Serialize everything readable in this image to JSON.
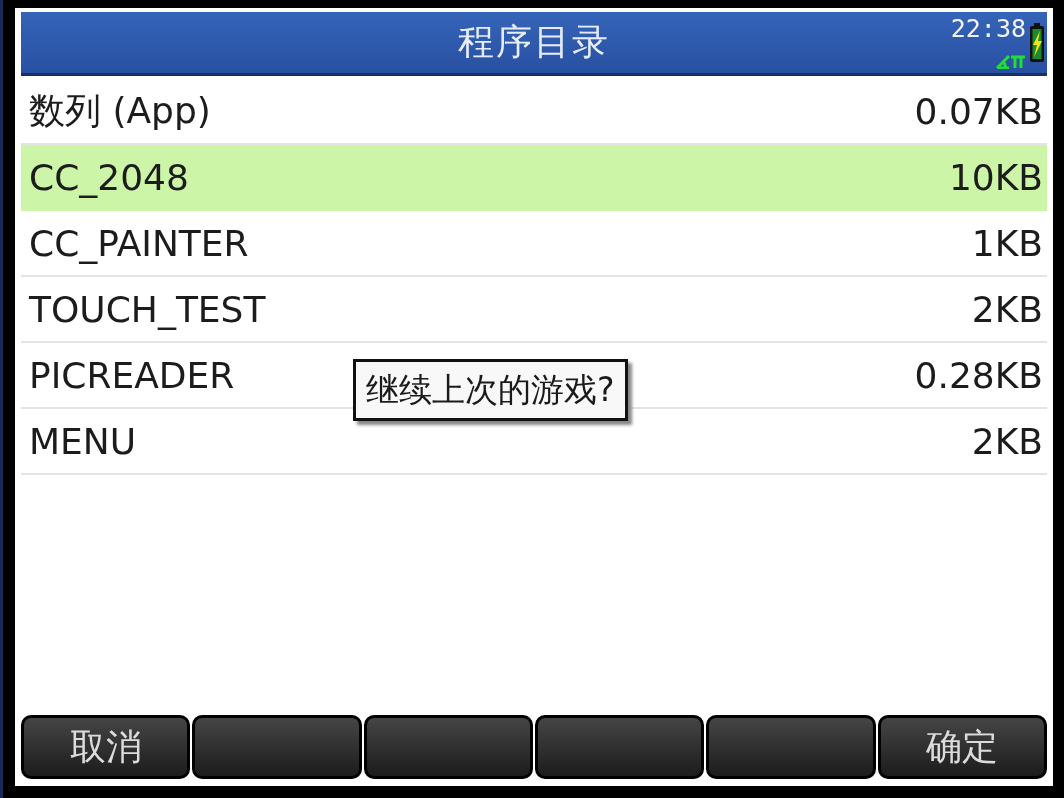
{
  "header": {
    "title": "程序目录",
    "time": "22:38"
  },
  "programs": [
    {
      "name": "数列 (App)",
      "size": "0.07KB",
      "selected": false
    },
    {
      "name": "CC_2048",
      "size": "10KB",
      "selected": true
    },
    {
      "name": "CC_PAINTER",
      "size": "1KB",
      "selected": false
    },
    {
      "name": "TOUCH_TEST",
      "size": "2KB",
      "selected": false
    },
    {
      "name": "PICREADER",
      "size": "0.28KB",
      "selected": false
    },
    {
      "name": "MENU",
      "size": "2KB",
      "selected": false
    }
  ],
  "dialog": {
    "message": "继续上次的游戏?"
  },
  "softkeys": [
    {
      "kind": "labeled",
      "label": "取消"
    },
    {
      "kind": "blank"
    },
    {
      "kind": "blank"
    },
    {
      "kind": "blank"
    },
    {
      "kind": "blank"
    },
    {
      "kind": "labeled",
      "label": "确定"
    }
  ]
}
